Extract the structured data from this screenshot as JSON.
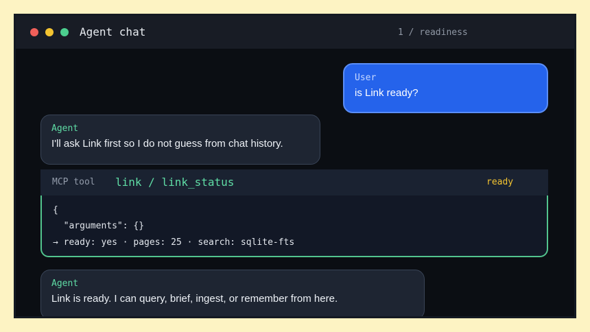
{
  "window": {
    "title": "Agent chat",
    "session": "1 / readiness"
  },
  "messages": [
    {
      "role": "User",
      "text": "is Link ready?"
    },
    {
      "role": "Agent",
      "text": "I'll ask Link first so I do not guess from chat history."
    },
    {
      "role": "Agent",
      "text": "Link is ready. I can query, brief, ingest, or remember from here."
    }
  ],
  "tool": {
    "kind": "MCP tool",
    "name": "link / link_status",
    "status": "ready",
    "lines": [
      "{",
      "  \"arguments\": {}",
      "→ ready: yes · pages: 25 · search: sqlite-fts"
    ]
  },
  "colors": {
    "user_bubble": "#2563eb",
    "agent_bubble": "#1e2532",
    "accent_green": "#5fdca5",
    "status_yellow": "#f4c431"
  }
}
